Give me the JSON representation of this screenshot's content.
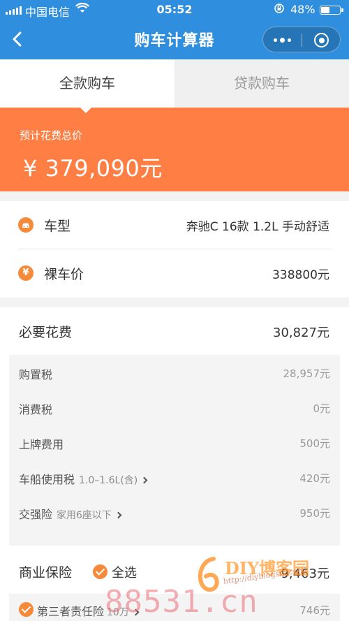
{
  "status_bar": {
    "carrier": "中国电信",
    "time": "05:52",
    "battery_percent_label": "48%",
    "battery_level": 0.48
  },
  "nav": {
    "title": "购车计算器"
  },
  "tabs": [
    {
      "label": "全款购车",
      "active": true
    },
    {
      "label": "贷款购车",
      "active": false
    }
  ],
  "total": {
    "label": "预计花费总价",
    "value": "¥ 379,090元"
  },
  "car": {
    "model_label": "车型",
    "model_icon_glyph": "",
    "model_value": "奔驰C 16款 1.2L 手动舒适",
    "price_label": "裸车价",
    "price_icon_glyph": "¥",
    "price_value": "338800元"
  },
  "necessary": {
    "label": "必要花费",
    "value": "30,827元",
    "items": [
      {
        "label": "购置税",
        "hint": "",
        "value": "28,957元"
      },
      {
        "label": "消费税",
        "hint": "",
        "value": "0元"
      },
      {
        "label": "上牌费用",
        "hint": "",
        "value": "500元"
      },
      {
        "label": "车船使用税",
        "hint": "1.0–1.6L(含)",
        "value": "420元"
      },
      {
        "label": "交强险",
        "hint": "家用6座以下",
        "value": "950元"
      }
    ]
  },
  "insurance": {
    "label": "商业保险",
    "select_all": "全选",
    "value": "9,463元",
    "items": [
      {
        "label": "第三者责任险",
        "hint": "10万",
        "value": "746元"
      }
    ]
  },
  "watermark": {
    "brand": "DIY博客园",
    "url": "http://diyblogsm.com",
    "domain": "88531.cn"
  },
  "colors": {
    "nav_blue": "#2f8fde",
    "accent_orange": "#ff7e44",
    "icon_orange": "#f58a3a"
  }
}
